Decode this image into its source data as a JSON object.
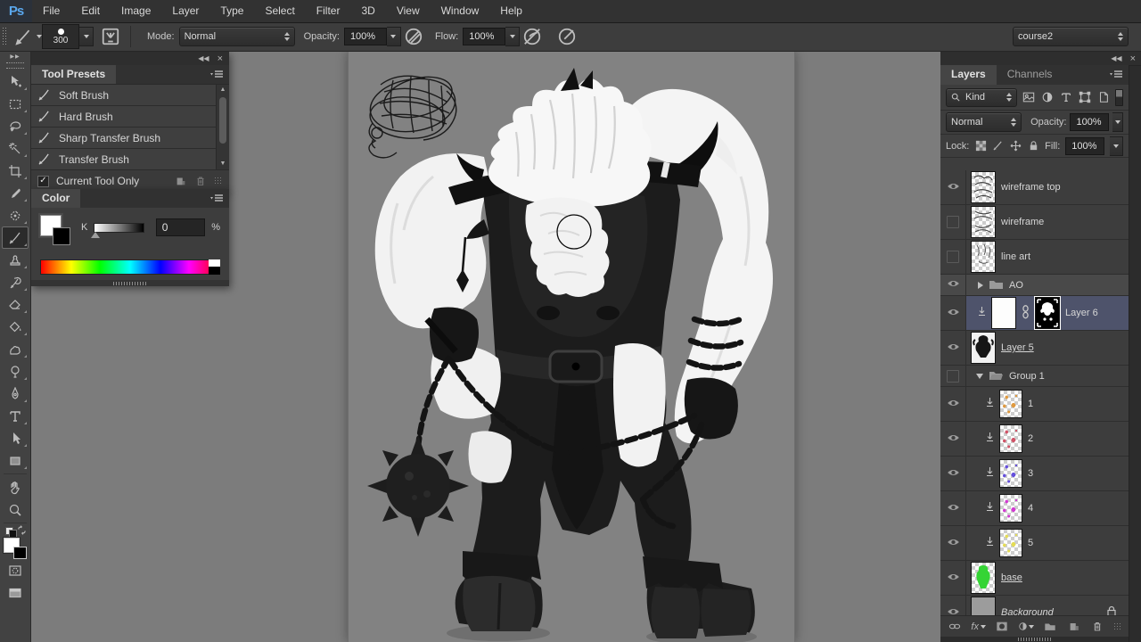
{
  "app": {
    "logo": "Ps",
    "logo_color": "#5aa8ee"
  },
  "menubar": {
    "items": [
      "File",
      "Edit",
      "Image",
      "Layer",
      "Type",
      "Select",
      "Filter",
      "3D",
      "View",
      "Window",
      "Help"
    ]
  },
  "options_bar": {
    "brush_size": "300",
    "mode_label": "Mode:",
    "mode_value": "Normal",
    "opacity_label": "Opacity:",
    "opacity_value": "100%",
    "flow_label": "Flow:",
    "flow_value": "100%",
    "workspace_value": "course2",
    "icons": [
      "brush-tool-icon",
      "brush-preset-picker",
      "toggle-brush-panel-icon",
      "pressure-opacity-icon",
      "airbrush-off-icon",
      "airbrush-icon"
    ]
  },
  "toolbar": {
    "selected_tool": "brush",
    "tools": [
      "move",
      "rectangular-marquee",
      "lasso",
      "magic-wand",
      "crop",
      "eyedropper",
      "spot-healing-brush",
      "brush",
      "clone-stamp",
      "history-brush",
      "eraser",
      "paint-bucket",
      "smudge",
      "dodge",
      "pen",
      "type",
      "path-selection",
      "rectangle",
      "hand",
      "zoom"
    ],
    "extras": [
      "default-colors",
      "swap-colors",
      "foreground-background-swatches",
      "quick-mask",
      "screen-mode"
    ]
  },
  "tool_presets_panel": {
    "title": "Tool Presets",
    "items": [
      "Soft Brush",
      "Hard Brush",
      "Sharp Transfer Brush",
      "Transfer Brush"
    ],
    "footer_checkbox_label": "Current Tool Only",
    "footer_checkbox_checked": true,
    "footer_icons": [
      "new-preset-icon",
      "delete-icon"
    ]
  },
  "color_panel": {
    "title": "Color",
    "channel_label": "K",
    "value": "0",
    "unit": "%",
    "foreground": "#ffffff",
    "background_swatch": "#000000"
  },
  "layers_panel": {
    "tabs": {
      "active": "Layers",
      "inactive": "Channels"
    },
    "kind_label": "Kind",
    "filter_icons": [
      "pixel-filter-icon",
      "adjustment-filter-icon",
      "type-filter-icon",
      "shape-filter-icon",
      "smart-object-filter-icon",
      "filter-toggle"
    ],
    "blend_mode": "Normal",
    "opacity_label": "Opacity:",
    "opacity_value": "100%",
    "lock_label": "Lock:",
    "lock_icons": [
      "lock-transparency-icon",
      "lock-paint-icon",
      "lock-position-icon",
      "lock-all-icon"
    ],
    "fill_label": "Fill:",
    "fill_value": "100%",
    "rows": [
      {
        "name": "wireframe top",
        "visible": true,
        "thumb": "wireframe-scribble"
      },
      {
        "name": "wireframe",
        "visible": false,
        "thumb": "wireframe-scribble"
      },
      {
        "name": "line art",
        "visible": false,
        "thumb": "lineart-scribble"
      },
      {
        "name": "AO",
        "visible": true,
        "type": "group-collapsed"
      },
      {
        "name": "Layer 6",
        "visible": true,
        "selected": true,
        "clipped": true,
        "thumb": "white-fill",
        "mask": "black-with-white-figure"
      },
      {
        "name": "Layer 5",
        "visible": true,
        "underlined": true,
        "thumb": "black-figure"
      },
      {
        "name": "Group 1",
        "visible": false,
        "type": "group-expanded"
      },
      {
        "name": "1",
        "visible": true,
        "clipped": true,
        "thumb_color": "#e09a40"
      },
      {
        "name": "2",
        "visible": true,
        "clipped": true,
        "thumb_color": "#d05468"
      },
      {
        "name": "3",
        "visible": true,
        "clipped": true,
        "thumb_color": "#6650dd"
      },
      {
        "name": "4",
        "visible": true,
        "clipped": true,
        "thumb_color": "#d23ad2"
      },
      {
        "name": "5",
        "visible": true,
        "clipped": true,
        "thumb_color": "#e4dc55"
      },
      {
        "name": "base",
        "visible": true,
        "underlined": true,
        "thumb_color": "#35d435"
      },
      {
        "name": "Background",
        "visible": true,
        "italic": true,
        "locked": true,
        "thumb": "gray-solid"
      }
    ],
    "footer_icons": [
      "link-layers-icon",
      "layer-style-icon",
      "add-mask-icon",
      "adjustment-layer-icon",
      "new-group-icon",
      "new-layer-icon",
      "delete-layer-icon"
    ]
  },
  "canvas": {
    "subject": "black and white minotaur sculpt render with flail, chains and hair wireframe sketch",
    "cursor": "brush-circle"
  },
  "icons": {
    "check": "✓",
    "close": "×",
    "collapse_left": "◀◀",
    "collapse_right": "▶▶"
  },
  "colors": {
    "selection": "#4e536b",
    "canvas_bg": "#828282",
    "pasteboard": "#7c7c7c",
    "accent": "#5aa8ee"
  }
}
